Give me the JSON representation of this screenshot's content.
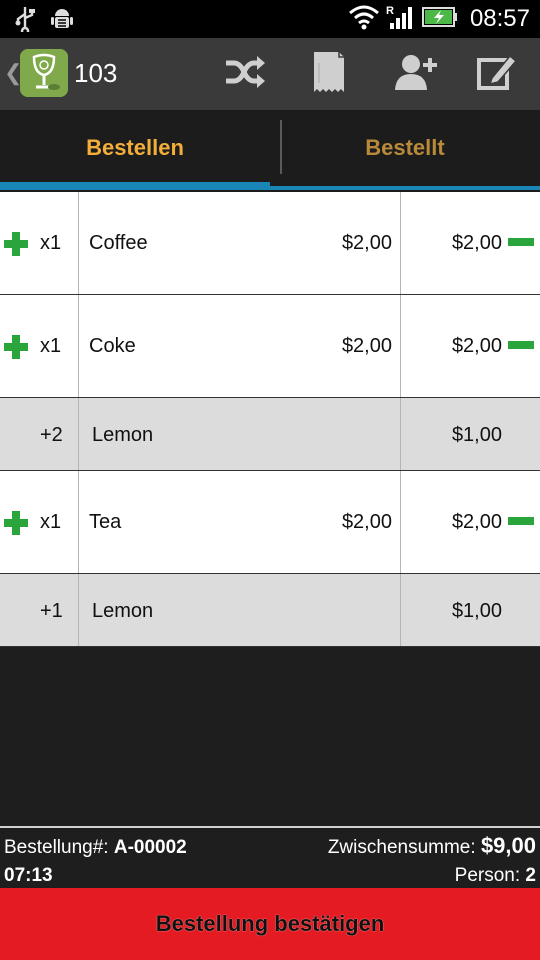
{
  "statusbar": {
    "time": "08:57",
    "roaming": "R"
  },
  "actionbar": {
    "table_number": "103"
  },
  "tabs": [
    {
      "label": "Bestellen",
      "active": true
    },
    {
      "label": "Bestellt",
      "active": false
    }
  ],
  "order": [
    {
      "type": "item",
      "qty": "x1",
      "name": "Coffee",
      "price": "$2,00",
      "total": "$2,00"
    },
    {
      "type": "item",
      "qty": "x1",
      "name": "Coke",
      "price": "$2,00",
      "total": "$2,00"
    },
    {
      "type": "modifier",
      "qty": "+2",
      "name": "Lemon",
      "total": "$1,00"
    },
    {
      "type": "item",
      "qty": "x1",
      "name": "Tea",
      "price": "$2,00",
      "total": "$2,00"
    },
    {
      "type": "modifier",
      "qty": "+1",
      "name": "Lemon",
      "total": "$1,00"
    }
  ],
  "footer": {
    "order_label": "Bestellung#:",
    "order_number": "A-00002",
    "time": "07:13",
    "subtotal_label": "Zwischensumme:",
    "subtotal": "$9,00",
    "persons_label": "Person:",
    "persons": "2"
  },
  "confirm_label": "Bestellung bestätigen",
  "colors": {
    "accent_green": "#2aa53b",
    "tab_active": "#f3ae3a",
    "tab_inactive": "#b88a3a",
    "underline": "#1a86b8",
    "confirm": "#e41b23"
  },
  "icons": [
    "usb-icon",
    "android-debug-icon",
    "wifi-icon",
    "signal-icon",
    "battery-charging-icon",
    "shuffle-icon",
    "receipt-icon",
    "add-person-icon",
    "edit-icon"
  ]
}
